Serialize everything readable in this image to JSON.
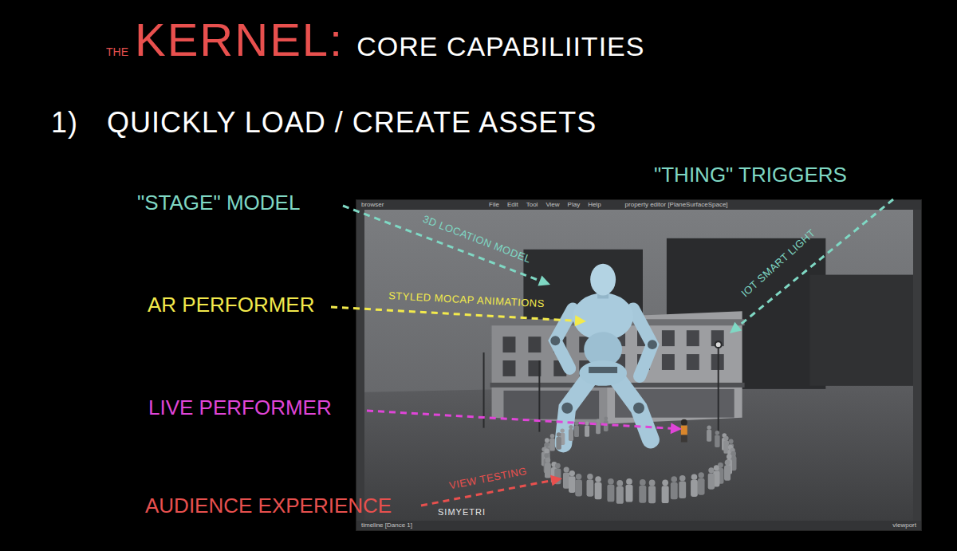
{
  "title": {
    "prefix": "THE",
    "name": "KERNEL:",
    "subtitle": "CORE CAPABILIITIES"
  },
  "heading": {
    "number": "1)",
    "text": "QUICKLY LOAD / CREATE ASSETS"
  },
  "callouts": [
    {
      "label": "\"STAGE\" MODEL",
      "annotation": "3D LOCATION MODEL",
      "color": "#7fd8c4"
    },
    {
      "label": "\"THING\" TRIGGERS",
      "annotation": "IOT SMART LIGHT",
      "color": "#7fd8c4"
    },
    {
      "label": "AR PERFORMER",
      "annotation": "STYLED MOCAP ANIMATIONS",
      "color": "#f3ea4c"
    },
    {
      "label": "LIVE PERFORMER",
      "color": "#e045d8"
    },
    {
      "label": "AUDIENCE EXPERIENCE",
      "annotation": "VIEW TESTING",
      "color": "#e8504e"
    }
  ],
  "app_window": {
    "browser": "browser",
    "menu": [
      "File",
      "Edit",
      "Tool",
      "View",
      "Play",
      "Help"
    ],
    "panel_title": "property editor [PlaneSurfaceSpace]",
    "timeline": "timeline [Dance 1]",
    "viewport": "viewport",
    "logo": "SIMYETRI"
  }
}
